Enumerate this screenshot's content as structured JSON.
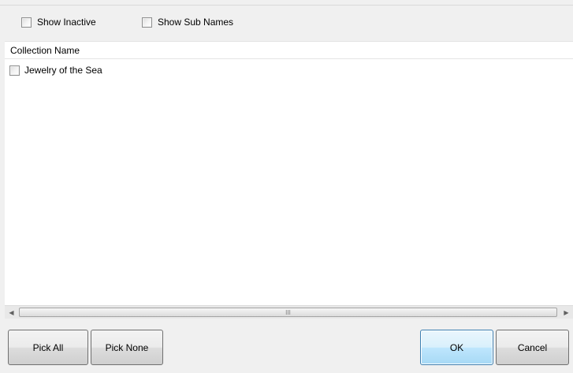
{
  "options": {
    "show_inactive": {
      "label": "Show Inactive",
      "checked": false
    },
    "show_sub_names": {
      "label": "Show Sub Names",
      "checked": false
    }
  },
  "list": {
    "column_header": "Collection Name",
    "items": [
      {
        "label": "Jewelry of the Sea",
        "checked": false
      }
    ]
  },
  "scrollbar": {
    "grip_glyph": "III",
    "left_arrow": "◀",
    "right_arrow": "▶"
  },
  "buttons": {
    "pick_all": "Pick All",
    "pick_none": "Pick None",
    "ok": "OK",
    "cancel": "Cancel"
  },
  "colors": {
    "default_button_border": "#3c7fb1",
    "list_background": "#ffffff",
    "dialog_background": "#f0f0f0"
  }
}
